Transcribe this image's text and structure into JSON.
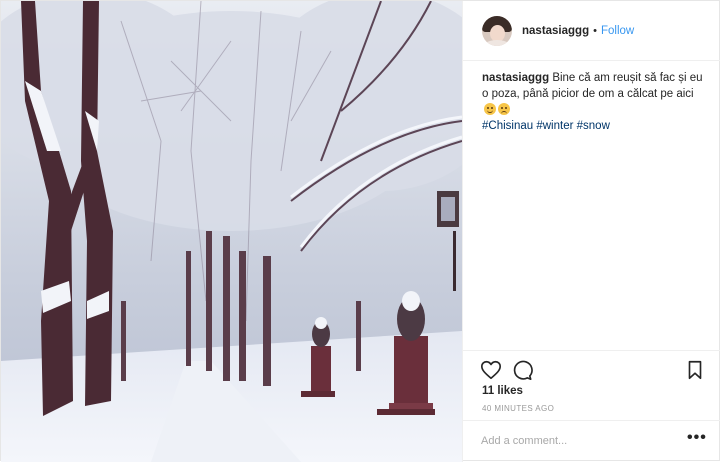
{
  "post": {
    "photo": {
      "alt": "",
      "icon": "photo"
    },
    "header": {
      "username": "nastasiaggg",
      "separator": "•",
      "follow_label": "Follow"
    },
    "caption": {
      "username": "nastasiaggg",
      "text": "Bine că am reușit să fac și eu o poza, până picior de om a călcat pe aici",
      "hashtags": [
        "#Chisinau",
        "#winter",
        "#snow"
      ]
    },
    "actions": {
      "like_icon": "heart-icon",
      "comment_icon": "comment-icon",
      "save_icon": "bookmark-icon"
    },
    "likes_label": "11 likes",
    "timestamp": "40 MINUTES AGO",
    "comment_box": {
      "placeholder": "Add a comment...",
      "more_icon": "more-icon"
    },
    "colors": {
      "link": "#3897f0",
      "hashtag": "#003569",
      "muted": "#999999",
      "border": "#efefef"
    }
  }
}
